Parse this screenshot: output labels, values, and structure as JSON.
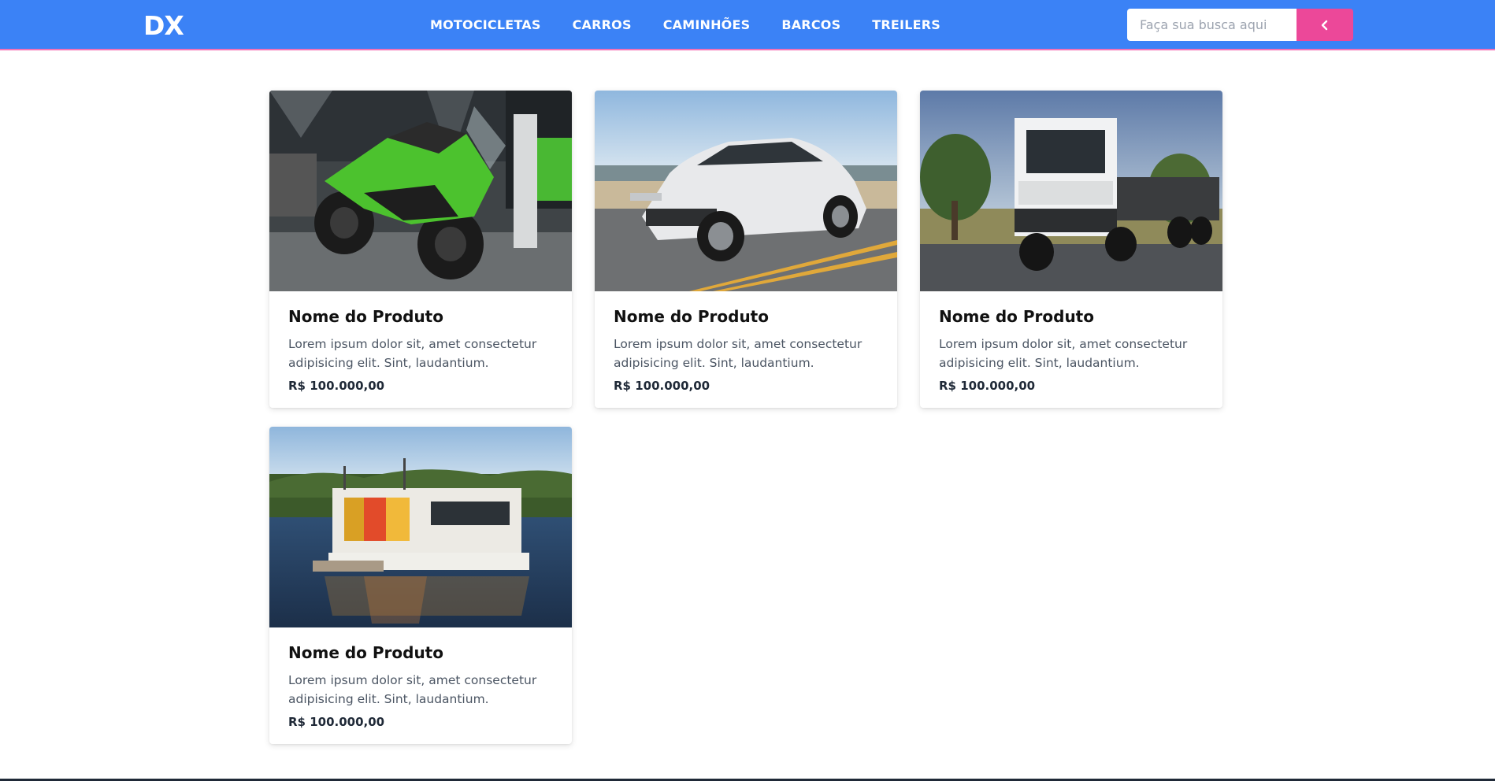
{
  "header": {
    "logo": "DX",
    "nav": [
      "MOTOCICLETAS",
      "CARROS",
      "CAMINHÕES",
      "BARCOS",
      "TREILERS"
    ],
    "search": {
      "placeholder": "Faça sua busca aqui",
      "button_icon": "chevron-left-icon"
    }
  },
  "products": [
    {
      "image": "motorcycle-photo",
      "title": "Nome do Produto",
      "description": "Lorem ipsum dolor sit, amet consectetur adipisicing elit. Sint, laudantium.",
      "price": "R$ 100.000,00"
    },
    {
      "image": "car-photo",
      "title": "Nome do Produto",
      "description": "Lorem ipsum dolor sit, amet consectetur adipisicing elit. Sint, laudantium.",
      "price": "R$ 100.000,00"
    },
    {
      "image": "truck-photo",
      "title": "Nome do Produto",
      "description": "Lorem ipsum dolor sit, amet consectetur adipisicing elit. Sint, laudantium.",
      "price": "R$ 100.000,00"
    },
    {
      "image": "boat-photo",
      "title": "Nome do Produto",
      "description": "Lorem ipsum dolor sit, amet consectetur adipisicing elit. Sint, laudantium.",
      "price": "R$ 100.000,00"
    }
  ],
  "colors": {
    "header": "#3b82f6",
    "accent": "#ec4899"
  }
}
